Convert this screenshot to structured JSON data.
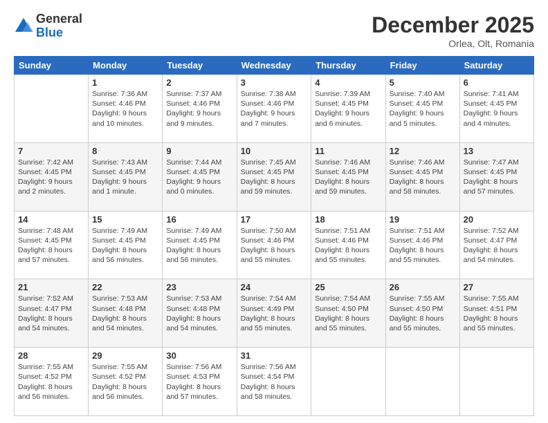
{
  "logo": {
    "general": "General",
    "blue": "Blue"
  },
  "title": "December 2025",
  "location": "Orlea, Olt, Romania",
  "days_header": [
    "Sunday",
    "Monday",
    "Tuesday",
    "Wednesday",
    "Thursday",
    "Friday",
    "Saturday"
  ],
  "weeks": [
    [
      {
        "num": "",
        "info": ""
      },
      {
        "num": "1",
        "info": "Sunrise: 7:36 AM\nSunset: 4:46 PM\nDaylight: 9 hours\nand 10 minutes."
      },
      {
        "num": "2",
        "info": "Sunrise: 7:37 AM\nSunset: 4:46 PM\nDaylight: 9 hours\nand 9 minutes."
      },
      {
        "num": "3",
        "info": "Sunrise: 7:38 AM\nSunset: 4:46 PM\nDaylight: 9 hours\nand 7 minutes."
      },
      {
        "num": "4",
        "info": "Sunrise: 7:39 AM\nSunset: 4:45 PM\nDaylight: 9 hours\nand 6 minutes."
      },
      {
        "num": "5",
        "info": "Sunrise: 7:40 AM\nSunset: 4:45 PM\nDaylight: 9 hours\nand 5 minutes."
      },
      {
        "num": "6",
        "info": "Sunrise: 7:41 AM\nSunset: 4:45 PM\nDaylight: 9 hours\nand 4 minutes."
      }
    ],
    [
      {
        "num": "7",
        "info": "Sunrise: 7:42 AM\nSunset: 4:45 PM\nDaylight: 9 hours\nand 2 minutes."
      },
      {
        "num": "8",
        "info": "Sunrise: 7:43 AM\nSunset: 4:45 PM\nDaylight: 9 hours\nand 1 minute."
      },
      {
        "num": "9",
        "info": "Sunrise: 7:44 AM\nSunset: 4:45 PM\nDaylight: 9 hours\nand 0 minutes."
      },
      {
        "num": "10",
        "info": "Sunrise: 7:45 AM\nSunset: 4:45 PM\nDaylight: 8 hours\nand 59 minutes."
      },
      {
        "num": "11",
        "info": "Sunrise: 7:46 AM\nSunset: 4:45 PM\nDaylight: 8 hours\nand 59 minutes."
      },
      {
        "num": "12",
        "info": "Sunrise: 7:46 AM\nSunset: 4:45 PM\nDaylight: 8 hours\nand 58 minutes."
      },
      {
        "num": "13",
        "info": "Sunrise: 7:47 AM\nSunset: 4:45 PM\nDaylight: 8 hours\nand 57 minutes."
      }
    ],
    [
      {
        "num": "14",
        "info": "Sunrise: 7:48 AM\nSunset: 4:45 PM\nDaylight: 8 hours\nand 57 minutes."
      },
      {
        "num": "15",
        "info": "Sunrise: 7:49 AM\nSunset: 4:45 PM\nDaylight: 8 hours\nand 56 minutes."
      },
      {
        "num": "16",
        "info": "Sunrise: 7:49 AM\nSunset: 4:45 PM\nDaylight: 8 hours\nand 56 minutes."
      },
      {
        "num": "17",
        "info": "Sunrise: 7:50 AM\nSunset: 4:46 PM\nDaylight: 8 hours\nand 55 minutes."
      },
      {
        "num": "18",
        "info": "Sunrise: 7:51 AM\nSunset: 4:46 PM\nDaylight: 8 hours\nand 55 minutes."
      },
      {
        "num": "19",
        "info": "Sunrise: 7:51 AM\nSunset: 4:46 PM\nDaylight: 8 hours\nand 55 minutes."
      },
      {
        "num": "20",
        "info": "Sunrise: 7:52 AM\nSunset: 4:47 PM\nDaylight: 8 hours\nand 54 minutes."
      }
    ],
    [
      {
        "num": "21",
        "info": "Sunrise: 7:52 AM\nSunset: 4:47 PM\nDaylight: 8 hours\nand 54 minutes."
      },
      {
        "num": "22",
        "info": "Sunrise: 7:53 AM\nSunset: 4:48 PM\nDaylight: 8 hours\nand 54 minutes."
      },
      {
        "num": "23",
        "info": "Sunrise: 7:53 AM\nSunset: 4:48 PM\nDaylight: 8 hours\nand 54 minutes."
      },
      {
        "num": "24",
        "info": "Sunrise: 7:54 AM\nSunset: 4:49 PM\nDaylight: 8 hours\nand 55 minutes."
      },
      {
        "num": "25",
        "info": "Sunrise: 7:54 AM\nSunset: 4:50 PM\nDaylight: 8 hours\nand 55 minutes."
      },
      {
        "num": "26",
        "info": "Sunrise: 7:55 AM\nSunset: 4:50 PM\nDaylight: 8 hours\nand 55 minutes."
      },
      {
        "num": "27",
        "info": "Sunrise: 7:55 AM\nSunset: 4:51 PM\nDaylight: 8 hours\nand 55 minutes."
      }
    ],
    [
      {
        "num": "28",
        "info": "Sunrise: 7:55 AM\nSunset: 4:52 PM\nDaylight: 8 hours\nand 56 minutes."
      },
      {
        "num": "29",
        "info": "Sunrise: 7:55 AM\nSunset: 4:52 PM\nDaylight: 8 hours\nand 56 minutes."
      },
      {
        "num": "30",
        "info": "Sunrise: 7:56 AM\nSunset: 4:53 PM\nDaylight: 8 hours\nand 57 minutes."
      },
      {
        "num": "31",
        "info": "Sunrise: 7:56 AM\nSunset: 4:54 PM\nDaylight: 8 hours\nand 58 minutes."
      },
      {
        "num": "",
        "info": ""
      },
      {
        "num": "",
        "info": ""
      },
      {
        "num": "",
        "info": ""
      }
    ]
  ]
}
